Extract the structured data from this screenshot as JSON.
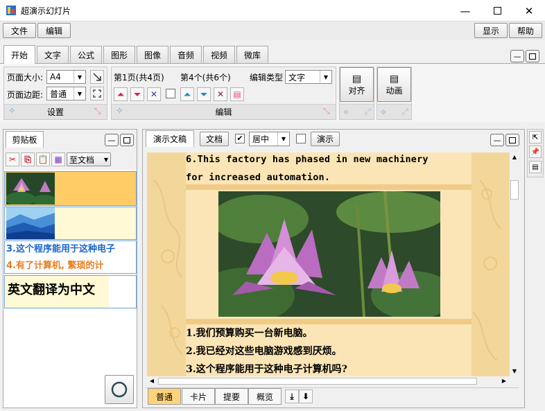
{
  "window": {
    "title": "超演示幻灯片"
  },
  "menu": {
    "file": "文件",
    "edit": "编辑",
    "display": "显示",
    "help": "帮助"
  },
  "ribbon": {
    "tabs": [
      "开始",
      "文字",
      "公式",
      "图形",
      "图像",
      "音频",
      "视频",
      "微库"
    ],
    "page_size_label": "页面大小:",
    "page_size_value": "A4",
    "page_margin_label": "页面边距:",
    "page_margin_value": "普通",
    "settings_group": "设置",
    "page_info": "第1页(共4页)",
    "item_info": "第4个(共6个)",
    "edit_type_label": "编辑类型",
    "edit_type_value": "文字",
    "edit_group": "编辑",
    "align_label": "对齐",
    "animation_label": "动画"
  },
  "clipboard": {
    "tab": "剪贴板",
    "to_doc": "至文档",
    "text_item_1": "3.这个程序能用于这种电子",
    "text_item_2": "4.有了计算机, 繁琐的计",
    "text_item_3": "英文翻译为中文"
  },
  "editor": {
    "tab": "演示文稿",
    "doc_button": "文档",
    "align_value": "居中",
    "present_button": "演示",
    "slide": {
      "line1": "6.This factory has phased in new machinery",
      "line2": "for increased automation.",
      "cn1": "1.我们预算购买一台新电脑。",
      "cn2": "2.我已经对这些电脑游戏感到厌烦。",
      "cn3": "3.这个程序能用于这种电子计算机吗?"
    },
    "view_tabs": [
      "普通",
      "卡片",
      "提要",
      "概览"
    ]
  },
  "colors": {
    "slide_bg": "#f3d79a",
    "clip_selected": "#ffcc66",
    "clip_bg": "#fff9d6",
    "text_blue": "#1b67c9",
    "text_orange": "#e67e22"
  }
}
